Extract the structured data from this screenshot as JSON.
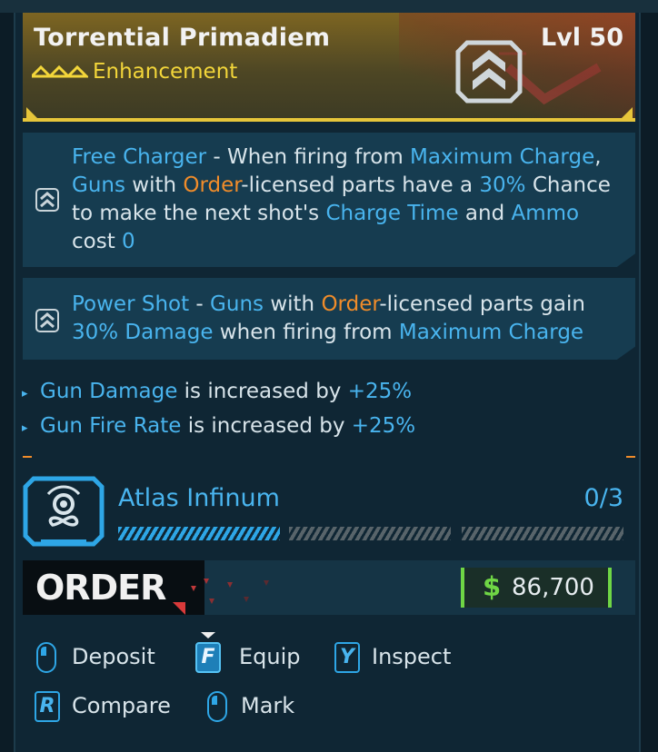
{
  "header": {
    "title": "Torrential Primadiem",
    "level": "Lvl 50",
    "subtype": "Enhancement",
    "accent": "#e6c53a"
  },
  "perks": [
    {
      "icon": "perk-chevron-icon",
      "parts": [
        {
          "t": "Free Charger",
          "c": "b"
        },
        {
          "t": " - When firing from ",
          "c": ""
        },
        {
          "t": "Maximum Charge",
          "c": "b"
        },
        {
          "t": ", ",
          "c": ""
        },
        {
          "t": "Guns",
          "c": "b"
        },
        {
          "t": " with ",
          "c": ""
        },
        {
          "t": "Order",
          "c": "o"
        },
        {
          "t": "-licensed parts have a ",
          "c": ""
        },
        {
          "t": "30%",
          "c": "b"
        },
        {
          "t": " Chance to make the next shot's ",
          "c": ""
        },
        {
          "t": "Charge Time",
          "c": "b"
        },
        {
          "t": " and ",
          "c": ""
        },
        {
          "t": "Ammo",
          "c": "b"
        },
        {
          "t": " cost ",
          "c": ""
        },
        {
          "t": "0",
          "c": "b"
        }
      ]
    },
    {
      "icon": "perk-chevron-icon",
      "parts": [
        {
          "t": "Power Shot",
          "c": "b"
        },
        {
          "t": " - ",
          "c": ""
        },
        {
          "t": "Guns",
          "c": "b"
        },
        {
          "t": " with ",
          "c": ""
        },
        {
          "t": "Order",
          "c": "o"
        },
        {
          "t": "-licensed parts gain ",
          "c": ""
        },
        {
          "t": "30% Damage",
          "c": "b"
        },
        {
          "t": " when firing from ",
          "c": ""
        },
        {
          "t": "Maximum Charge",
          "c": "b"
        }
      ]
    }
  ],
  "stats": [
    {
      "name": "Gun Damage",
      "mid": " is increased by ",
      "value": "+25%"
    },
    {
      "name": "Gun Fire Rate",
      "mid": " is increased by ",
      "value": "+25%"
    }
  ],
  "manufacturer": {
    "set_name": "Atlas Infinum",
    "count": "0/3",
    "progress": 1,
    "progress_total": 3,
    "brand": "ORDER"
  },
  "price": {
    "symbol": "$",
    "value": "86,700",
    "color": "#6fd645"
  },
  "actions": [
    {
      "key": "",
      "type": "mouse",
      "label": "Deposit"
    },
    {
      "key": "F",
      "type": "key",
      "label": "Equip",
      "active": true
    },
    {
      "key": "Y",
      "type": "key",
      "label": "Inspect"
    },
    {
      "key": "R",
      "type": "key",
      "label": "Compare"
    },
    {
      "key": "",
      "type": "mouse",
      "label": "Mark"
    }
  ],
  "colors": {
    "blue_highlight": "#49b4ee",
    "orange_highlight": "#f08c2a",
    "panel": "#163c50"
  }
}
